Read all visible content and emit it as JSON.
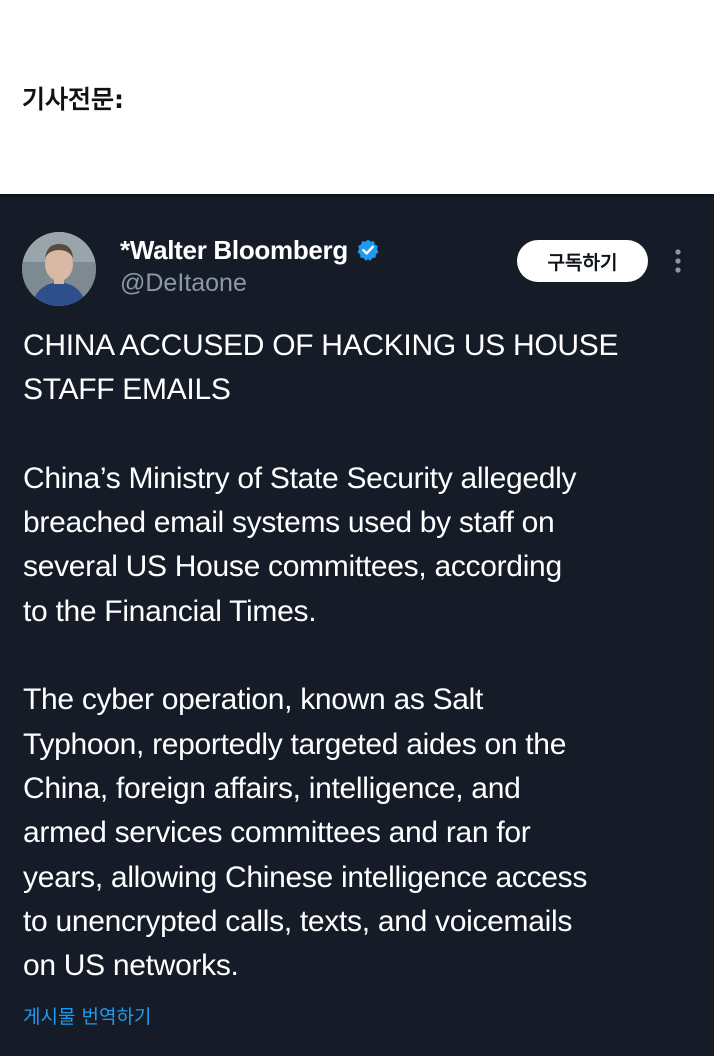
{
  "article": {
    "label": "기사전문:"
  },
  "tweet": {
    "display_name": "*Walter Bloomberg",
    "handle": "@DeItaone",
    "subscribe_label": "구독하기",
    "paragraphs": [
      [
        "CHINA ACCUSED OF HACKING US HOUSE",
        "STAFF EMAILS"
      ],
      [
        "China’s Ministry of State Security allegedly",
        "breached email systems used by staff on",
        "several US House committees, according",
        "to the Financial Times."
      ],
      [
        "The cyber operation, known as Salt",
        "Typhoon, reportedly targeted aides on the",
        "China, foreign affairs, intelligence, and",
        "armed services committees and ran for",
        "years, allowing Chinese intelligence access",
        "to unencrypted calls, texts, and voicemails",
        "on US networks."
      ]
    ],
    "translate_label": "게시물 번역하기"
  },
  "colors": {
    "background": "#151c28",
    "verified_badge": "#1d9bf0",
    "link": "#1d9bf0",
    "handle": "#8b98a5"
  },
  "icons": {
    "verified": "verified-badge-icon",
    "more": "more-options-icon"
  }
}
